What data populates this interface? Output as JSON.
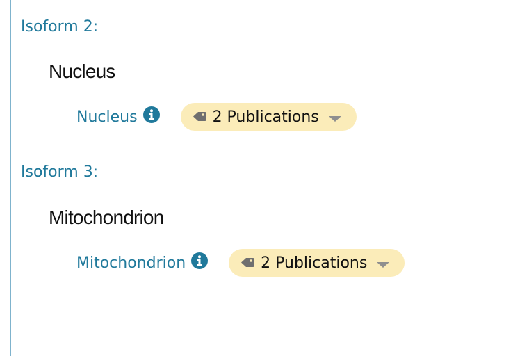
{
  "isoforms": [
    {
      "heading": "Isoform 2:",
      "location": "Nucleus",
      "term": {
        "label": "Nucleus",
        "info_icon": "info-circle-icon",
        "evidence": {
          "label": "2 Publications",
          "tag_icon": "tag-icon",
          "dropdown_icon": "chevron-down-icon"
        }
      }
    },
    {
      "heading": "Isoform 3:",
      "location": "Mitochondrion",
      "term": {
        "label": "Mitochondrion",
        "info_icon": "info-circle-icon",
        "evidence": {
          "label": "2 Publications",
          "tag_icon": "tag-icon",
          "dropdown_icon": "chevron-down-icon"
        }
      }
    }
  ],
  "colors": {
    "link": "#20799b",
    "text": "#111111",
    "pill_background": "#fbecb9",
    "left_rule": "#7fb3cd",
    "icon_gray": "#6f6f6f"
  }
}
